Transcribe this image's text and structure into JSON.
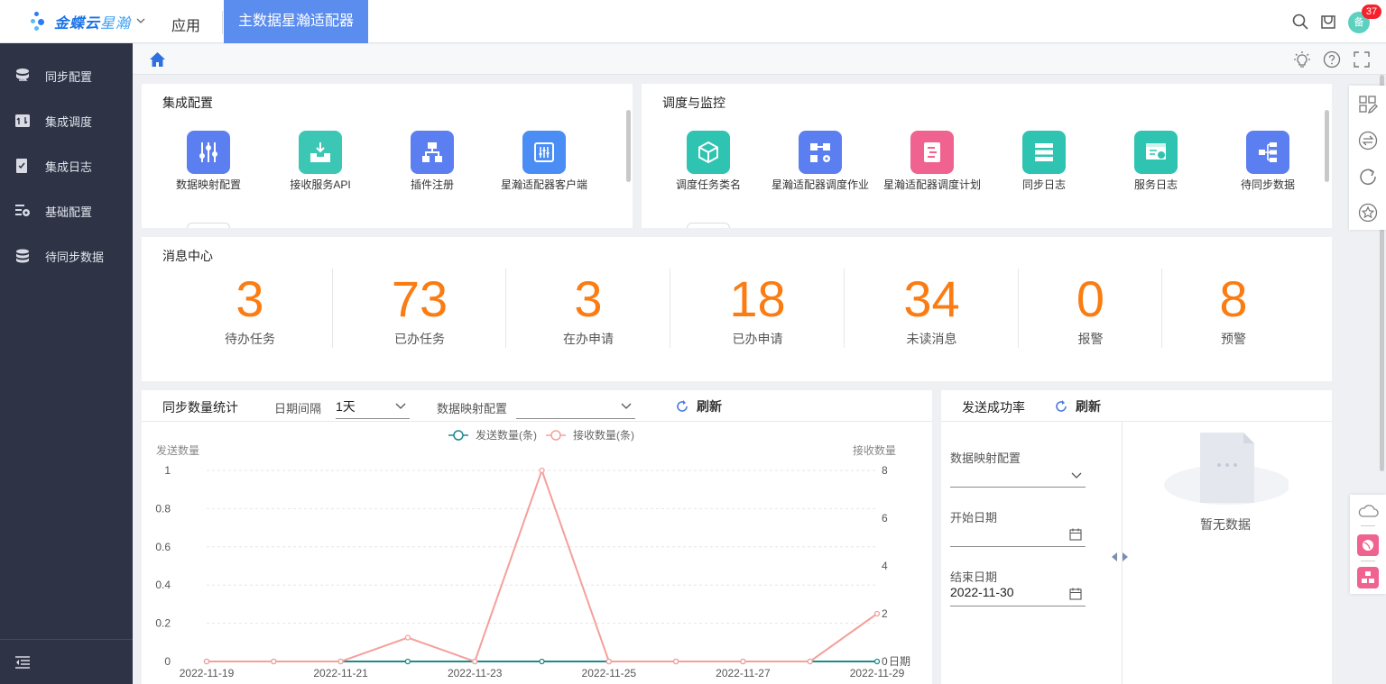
{
  "header": {
    "brand": "金蝶云",
    "brand_sub": "星瀚",
    "app_link": "应用",
    "active_tab": "主数据星瀚适配器",
    "avatar_text": "备",
    "badge_count": "37"
  },
  "sidebar": {
    "items": [
      {
        "label": "同步配置",
        "icon": "sync-config-icon"
      },
      {
        "label": "集成调度",
        "icon": "schedule-icon"
      },
      {
        "label": "集成日志",
        "icon": "log-icon"
      },
      {
        "label": "基础配置",
        "icon": "base-config-icon"
      },
      {
        "label": "待同步数据",
        "icon": "database-icon"
      }
    ]
  },
  "integration": {
    "title": "集成配置",
    "tiles": [
      {
        "label": "数据映射配置",
        "color": "#5b7ff0"
      },
      {
        "label": "接收服务API",
        "color": "#3cc6b4"
      },
      {
        "label": "插件注册",
        "color": "#5b7ff0"
      },
      {
        "label": "星瀚适配器客户端",
        "color": "#4a8df5"
      }
    ]
  },
  "monitor": {
    "title": "调度与监控",
    "tiles": [
      {
        "label": "调度任务类名",
        "color": "#2fc3b1"
      },
      {
        "label": "星瀚适配器调度作业",
        "color": "#5b7ff0"
      },
      {
        "label": "星瀚适配器调度计划",
        "color": "#f0628f"
      },
      {
        "label": "同步日志",
        "color": "#2fc3b1"
      },
      {
        "label": "服务日志",
        "color": "#2fc3b1"
      },
      {
        "label": "待同步数据",
        "color": "#5b7ff0"
      }
    ]
  },
  "messages": {
    "title": "消息中心",
    "stats": [
      {
        "value": "3",
        "label": "待办任务"
      },
      {
        "value": "73",
        "label": "已办任务"
      },
      {
        "value": "3",
        "label": "在办申请"
      },
      {
        "value": "18",
        "label": "已办申请"
      },
      {
        "value": "34",
        "label": "未读消息"
      },
      {
        "value": "0",
        "label": "报警"
      },
      {
        "value": "8",
        "label": "预警"
      }
    ]
  },
  "sync_stats": {
    "title": "同步数量统计",
    "interval_label": "日期间隔",
    "interval_value": "1天",
    "mapping_label": "数据映射配置",
    "refresh_label": "刷新"
  },
  "success_rate": {
    "title": "发送成功率",
    "refresh_label": "刷新",
    "mapping_label": "数据映射配置",
    "start_label": "开始日期",
    "end_label": "结束日期",
    "end_value": "2022-11-30",
    "empty_text": "暂无数据"
  },
  "chart_data": {
    "type": "line",
    "legend_position": "top",
    "y_left_label": "发送数量",
    "y_right_label": "接收数量",
    "x_axis_name": "日期",
    "y_left_ticks": [
      "0",
      "0.2",
      "0.4",
      "0.6",
      "0.8",
      "1"
    ],
    "y_right_ticks": [
      "0",
      "2",
      "4",
      "6",
      "8"
    ],
    "ylim_left": [
      0,
      1
    ],
    "ylim_right": [
      0,
      8
    ],
    "x": [
      "2022-11-19",
      "2022-11-20",
      "2022-11-21",
      "2022-11-22",
      "2022-11-23",
      "2022-11-24",
      "2022-11-25",
      "2022-11-26",
      "2022-11-27",
      "2022-11-28",
      "2022-11-29"
    ],
    "x_tick_labels": [
      "2022-11-19",
      "2022-11-21",
      "2022-11-23",
      "2022-11-25",
      "2022-11-27",
      "2022-11-29"
    ],
    "grid": true,
    "series": [
      {
        "name": "发送数量(条)",
        "axis": "left",
        "color": "#1f8a8a",
        "values": [
          0,
          0,
          0,
          0,
          0,
          0,
          0,
          0,
          0,
          0,
          0
        ]
      },
      {
        "name": "接收数量(条)",
        "axis": "right",
        "color": "#f5a09a",
        "values": [
          0,
          0,
          0,
          1,
          0,
          8,
          0,
          0,
          0,
          0,
          2
        ]
      }
    ]
  }
}
